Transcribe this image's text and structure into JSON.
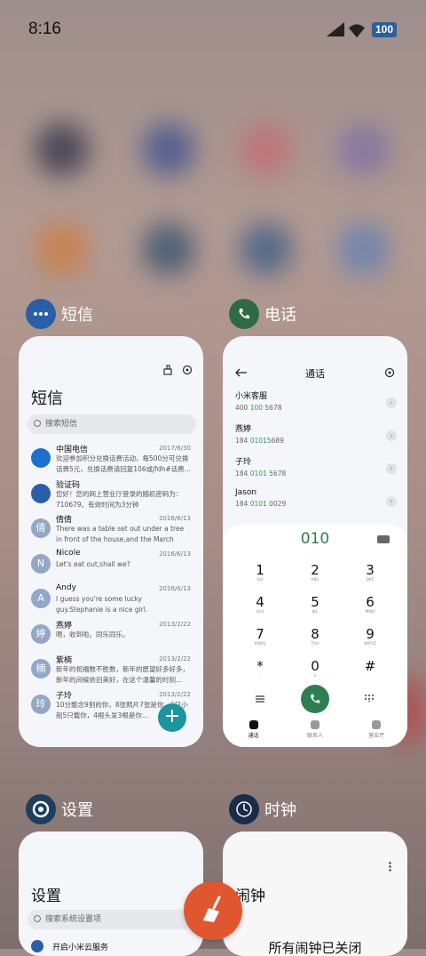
{
  "status_bar": {
    "time": "8:16",
    "battery": "100"
  },
  "cards": {
    "sms": {
      "app_name": "短信",
      "title": "短信",
      "search_placeholder": "搜索短信",
      "messages": [
        {
          "name": "中国电信",
          "date": "2017/6/30",
          "preview": "欢迎参加积分兑换话费活动，每500分可兑换话费5元，兑换话费请回复106或jfdh#话费...",
          "avatar": "",
          "color": "#1e6fd0"
        },
        {
          "name": "验证码",
          "date": "",
          "preview": "您好！您的网上营业厅登录的随机密码为：710679。有效时间为3分钟",
          "avatar": "",
          "color": "#2a5ea8"
        },
        {
          "name": "倩倩",
          "date": "2016/6/13",
          "preview": "There was a table set out under a tree in front of the house,and the March Hare an...",
          "avatar": "倩",
          "color": "#93a7c7"
        },
        {
          "name": "Nicole",
          "date": "2016/6/13",
          "preview": "Let's eat out,shall we?",
          "avatar": "N",
          "color": "#93a7c7"
        },
        {
          "name": "Andy",
          "date": "2016/6/13",
          "preview": "I guess you're some lucky guy.Stephanie is a nice girl.",
          "avatar": "A",
          "color": "#93a7c7"
        },
        {
          "name": "燕婷",
          "date": "2013/2/22",
          "preview": "嗯，收到啦。同乐同乐。",
          "avatar": "婷",
          "color": "#93a7c7"
        },
        {
          "name": "紫楠",
          "date": "2013/2/22",
          "preview": "新年的祝福数不胜数，新年的愿望好多好多，新年的间候依旧美好，在这个温馨的时刻...",
          "avatar": "楠",
          "color": "#93a7c7"
        },
        {
          "name": "子玲",
          "date": "2013/2/22",
          "preview": "10分整念9割的你，8张照片7张是你，6只小船5只载你，4根头发3根是你...",
          "avatar": "玲",
          "color": "#93a7c7"
        }
      ]
    },
    "phone": {
      "app_name": "电话",
      "title": "通话",
      "contacts": [
        {
          "name": "小米客服",
          "num_pre": "400 ",
          "num_hl": "100",
          "num_post": " 5678"
        },
        {
          "name": "燕婷",
          "num_pre": "184 ",
          "num_hl": "0101",
          "num_post": "5689"
        },
        {
          "name": "子玲",
          "num_pre": "184 ",
          "num_hl": "0101",
          "num_post": " 5678"
        },
        {
          "name": "Jason",
          "num_pre": "184 ",
          "num_hl": "0101",
          "num_post": " 0029"
        }
      ],
      "dialed_number": "010",
      "keys": [
        {
          "d": "1",
          "l": "GO"
        },
        {
          "d": "2",
          "l": "ABC"
        },
        {
          "d": "3",
          "l": "DEF"
        },
        {
          "d": "4",
          "l": "GHI"
        },
        {
          "d": "5",
          "l": "JKL"
        },
        {
          "d": "6",
          "l": "MNO"
        },
        {
          "d": "7",
          "l": "PQRS"
        },
        {
          "d": "8",
          "l": "TUV"
        },
        {
          "d": "9",
          "l": "WXYZ"
        },
        {
          "d": "*",
          "l": ","
        },
        {
          "d": "0",
          "l": "+"
        },
        {
          "d": "#",
          "l": ""
        }
      ],
      "tabs": [
        "通话",
        "联系人",
        "营业厅"
      ]
    },
    "settings": {
      "app_name": "设置",
      "title": "设置",
      "search_placeholder": "搜索系统设置项",
      "first_item": "开启小米云服务"
    },
    "clock": {
      "app_name": "时钟",
      "title": "闹钟",
      "message": "所有闹钟已关闭"
    }
  },
  "colors": {
    "accent_green": "#2e7a50",
    "fab_teal": "#1d94a0",
    "cleaner_orange": "#e0572f"
  }
}
